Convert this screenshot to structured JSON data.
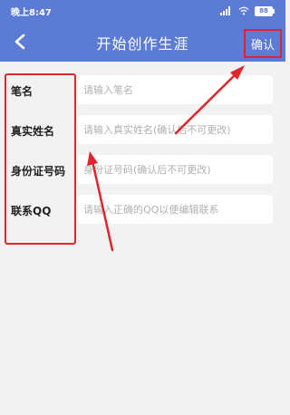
{
  "status_bar": {
    "time": "晚上8:47",
    "battery": "88"
  },
  "header": {
    "title": "开始创作生涯",
    "confirm_label": "确认"
  },
  "form": {
    "fields": [
      {
        "label": "笔名",
        "placeholder": "请输入笔名",
        "value": ""
      },
      {
        "label": "真实姓名",
        "placeholder": "请输入真实姓名(确认后不可更改)",
        "value": ""
      },
      {
        "label": "身份证号码",
        "placeholder": "身份证号码(确认后不可更改)",
        "value": ""
      },
      {
        "label": "联系QQ",
        "placeholder": "请输入正确的QQ以便编辑联系",
        "value": ""
      }
    ]
  },
  "colors": {
    "primary": "#5b7bd5",
    "background": "#f2f2f2",
    "annotation": "#e0242b"
  }
}
